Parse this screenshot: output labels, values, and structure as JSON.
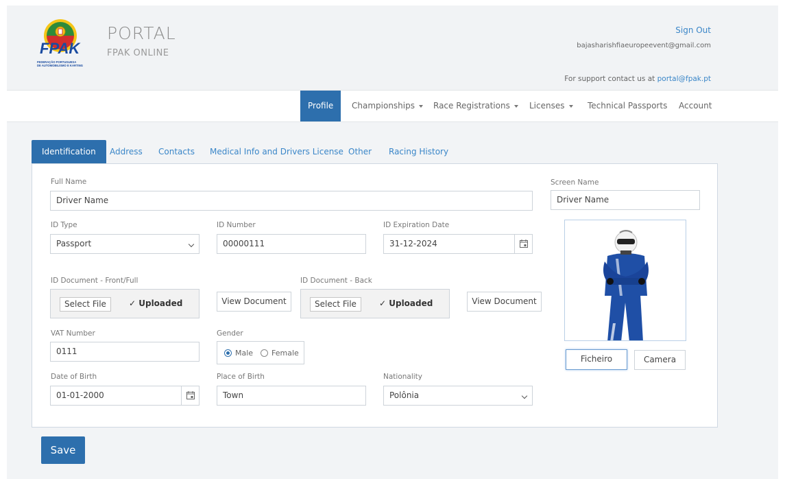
{
  "header": {
    "logo_text": "FPAK",
    "logo_caption": "FEDERAÇÃO PORTUGUESA DE AUTOMOBILISMO E KARTING",
    "title": "PORTAL",
    "subtitle": "FPAK ONLINE",
    "sign_out": "Sign Out",
    "email": "bajasharishfiaeuropeevent@gmail.com",
    "support_prefix": "For support contact us at ",
    "support_email": "portal@fpak.pt"
  },
  "nav": {
    "items": [
      {
        "label": "Profile",
        "active": true
      },
      {
        "label": "Championships",
        "dropdown": true
      },
      {
        "label": "Race Registrations",
        "dropdown": true
      },
      {
        "label": "Licenses",
        "dropdown": true
      },
      {
        "label": "Technical Passports"
      },
      {
        "label": "Account"
      }
    ]
  },
  "tabs": [
    {
      "label": "Identification",
      "active": true
    },
    {
      "label": "Address"
    },
    {
      "label": "Contacts"
    },
    {
      "label": "Medical Info and Drivers License"
    },
    {
      "label": "Other"
    },
    {
      "label": "Racing History"
    }
  ],
  "form": {
    "full_name": {
      "label": "Full Name",
      "value": "Driver Name"
    },
    "screen_name": {
      "label": "Screen Name",
      "value": "Driver Name"
    },
    "id_type": {
      "label": "ID Type",
      "value": "Passport"
    },
    "id_number": {
      "label": "ID Number",
      "value": "00000111"
    },
    "id_expiration": {
      "label": "ID Expiration Date",
      "value": "31-12-2024"
    },
    "id_front": {
      "label": "ID Document - Front/Full",
      "select_label": "Select File",
      "status": "✓ Uploaded",
      "view_label": "View Document"
    },
    "id_back": {
      "label": "ID Document - Back",
      "select_label": "Select File",
      "status": "✓ Uploaded",
      "view_label": "View Document"
    },
    "vat": {
      "label": "VAT Number",
      "value": "0111"
    },
    "gender": {
      "label": "Gender",
      "options": [
        "Male",
        "Female"
      ],
      "selected": "Male"
    },
    "dob": {
      "label": "Date of Birth",
      "value": "01-01-2000"
    },
    "pob": {
      "label": "Place of Birth",
      "value": "Town"
    },
    "nationality": {
      "label": "Nationality",
      "value": "Polônia"
    }
  },
  "photo": {
    "file_button": "Ficheiro",
    "camera_button": "Camera"
  },
  "save_label": "Save",
  "colors": {
    "primary": "#2d6fad",
    "link": "#3a86c8",
    "suit_blue": "#1f4fa6"
  }
}
